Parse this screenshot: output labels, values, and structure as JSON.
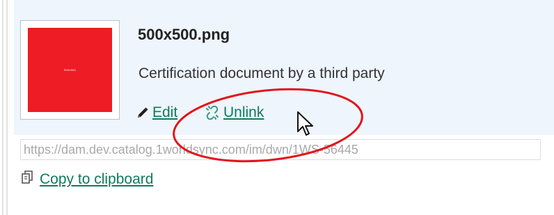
{
  "asset": {
    "filename": "500x500.png",
    "description": "Certification document by a third party",
    "thumbnail_caption": "500x500",
    "thumbnail_color": "#ee1c25"
  },
  "actions": {
    "edit_label": "Edit",
    "edit_icon": "pencil-icon",
    "unlink_label": "Unlink",
    "unlink_icon": "unlink-icon"
  },
  "url_field": {
    "value": "https://dam.dev.catalog.1worldsync.com/im/dwn/1WS-56445"
  },
  "copy": {
    "label": "Copy to clipboard",
    "icon": "clipboard-icon"
  },
  "colors": {
    "link": "#0f7a5e",
    "annotation": "#e3141b",
    "card_background": "#eef5fc"
  }
}
